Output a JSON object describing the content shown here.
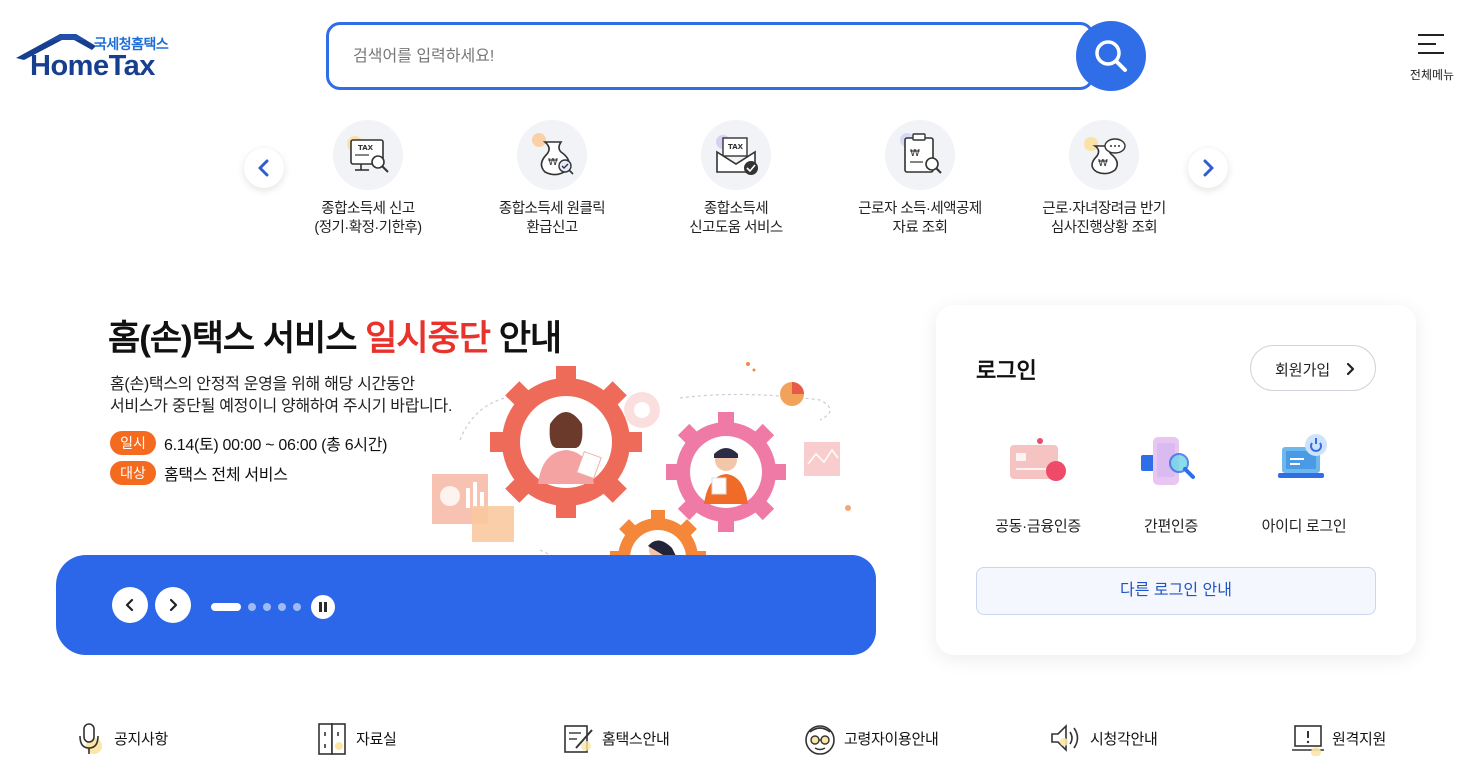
{
  "header": {
    "logo_sub": "국세청홈택스",
    "logo_brand": "HomeTax",
    "search_placeholder": "검색어를 입력하세요!",
    "all_menu_label": "전체메뉴"
  },
  "quick_menu": {
    "items": [
      {
        "line1": "종합소득세 신고",
        "line2": "(정기·확정·기한후)",
        "icon": "tax-monitor-search-icon"
      },
      {
        "line1": "종합소득세 원클릭",
        "line2": "환급신고",
        "icon": "money-bag-check-icon"
      },
      {
        "line1": "종합소득세",
        "line2": "신고도움 서비스",
        "icon": "tax-envelope-check-icon"
      },
      {
        "line1": "근로자 소득·세액공제",
        "line2": "자료 조회",
        "icon": "clipboard-search-icon"
      },
      {
        "line1": "근로·자녀장려금 반기",
        "line2": "심사진행상황 조회",
        "icon": "money-bag-chat-icon"
      }
    ]
  },
  "banner": {
    "title_prefix": "홈(손)택스 서비스 ",
    "title_highlight": "일시중단",
    "title_suffix": " 안내",
    "desc_line1": "홈(손)택스의 안정적 운영을 위해 해당 시간동안",
    "desc_line2": "서비스가  중단될 예정이니 양해하여 주시기 바랍니다.",
    "tag1": "일시",
    "tag1_text": "6.14(토) 00:00 ~ 06:00 (총 6시간)",
    "tag2": "대상",
    "tag2_text": "홈택스 전체 서비스",
    "slide_count": 5,
    "active_slide": 1
  },
  "login": {
    "title": "로그인",
    "signup_label": "회원가입",
    "options": [
      {
        "label": "공동·금융인증",
        "icon": "certificate-card-icon"
      },
      {
        "label": "간편인증",
        "icon": "phone-search-icon"
      },
      {
        "label": "아이디 로그인",
        "icon": "laptop-power-icon"
      }
    ],
    "other_login_label": "다른 로그인 안내"
  },
  "bottom_menu": [
    {
      "label": "공지사항",
      "icon": "microphone-icon"
    },
    {
      "label": "자료실",
      "icon": "file-cabinet-icon"
    },
    {
      "label": "홈택스안내",
      "icon": "document-edit-icon"
    },
    {
      "label": "고령자이용안내",
      "icon": "glasses-icon"
    },
    {
      "label": "시청각안내",
      "icon": "speaker-icon"
    },
    {
      "label": "원격지원",
      "icon": "remote-support-icon"
    }
  ],
  "colors": {
    "primary_blue": "#2f6ee6",
    "banner_blue": "#2b67e8",
    "highlight_red": "#e8322b",
    "tag_orange": "#f46a1f",
    "logo_navy": "#173e8f"
  }
}
